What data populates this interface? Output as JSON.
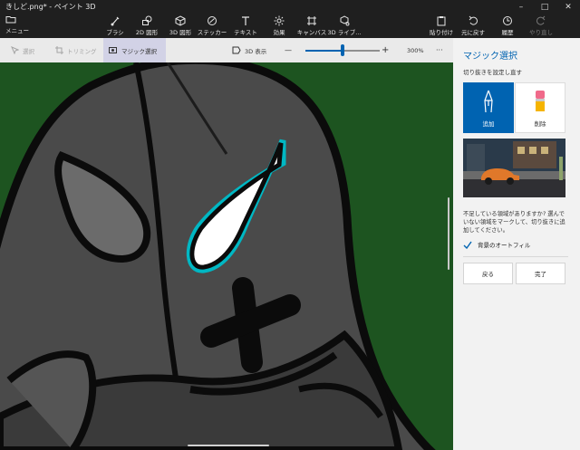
{
  "window": {
    "title": "きしど.png* - ペイント 3D",
    "controls": {
      "minimize": "–",
      "maximize": "□",
      "close": "✕"
    }
  },
  "toolbar": {
    "menu_label": "メニュー",
    "items": [
      {
        "label": "ブラシ",
        "icon": "brush-icon"
      },
      {
        "label": "2D 図形",
        "icon": "2d-shapes-icon"
      },
      {
        "label": "3D 図形",
        "icon": "3d-shapes-icon"
      },
      {
        "label": "ステッカー",
        "icon": "sticker-icon"
      },
      {
        "label": "テキスト",
        "icon": "text-icon"
      },
      {
        "label": "効果",
        "icon": "effects-icon"
      },
      {
        "label": "キャンバス",
        "icon": "canvas-icon"
      },
      {
        "label": "3D ライブ...",
        "icon": "3d-library-icon"
      }
    ],
    "right_items": [
      {
        "label": "貼り付け",
        "icon": "paste-icon"
      },
      {
        "label": "元に戻す",
        "icon": "undo-icon"
      },
      {
        "label": "履歴",
        "icon": "history-icon"
      },
      {
        "label": "やり直し",
        "icon": "redo-icon"
      }
    ]
  },
  "subtoolbar": {
    "select_label": "選択",
    "crop_label": "トリミング",
    "magic_select_label": "マジック選択",
    "view3d_label": "3D 表示",
    "zoom_out": "—",
    "zoom_in": "+",
    "zoom_value": "300%",
    "zoom_level": 0.5,
    "more": "···"
  },
  "panel": {
    "title": "マジック選択",
    "subtitle": "切り抜きを設定し直す",
    "add_label": "追加",
    "erase_label": "削除",
    "help_text": "不足している領域がありますか? 選んでいない領域をマークして、切り抜きに追加してください。",
    "autofill_label": "背景のオートフィル",
    "autofill_checked": true,
    "back_label": "戻る",
    "done_label": "完了"
  },
  "colors": {
    "accent": "#0063b1",
    "canvas_bg": "#1d5420",
    "panel_bg": "#f2f2f2"
  }
}
